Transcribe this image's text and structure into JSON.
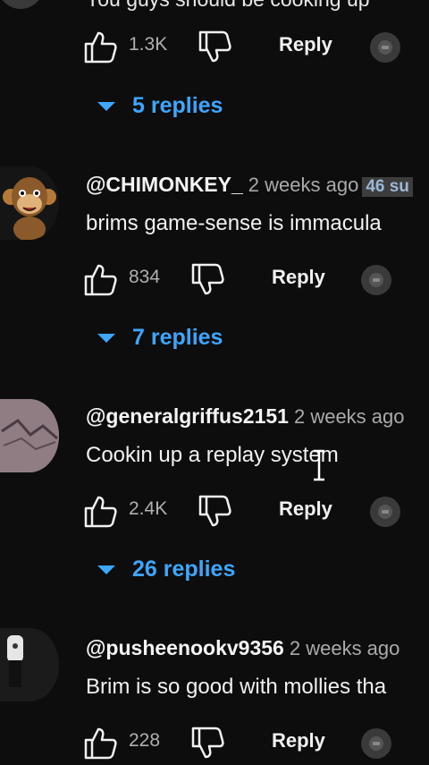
{
  "top_comment": {
    "text": "You guys should be cooking up",
    "likes": "1.3K",
    "reply_label": "Reply",
    "replies_label": "5 replies"
  },
  "comments": [
    {
      "handle": "@CHIMONKEY_",
      "time": "2 weeks ago",
      "badge": "46 su",
      "text": "brims game-sense is immacula",
      "likes": "834",
      "reply_label": "Reply",
      "replies_label": "7 replies"
    },
    {
      "handle": "@generalgriffus2151",
      "time": "2 weeks ago",
      "text": "Cookin up a replay system",
      "likes": "2.4K",
      "reply_label": "Reply",
      "replies_label": "26 replies"
    },
    {
      "handle": "@pusheenookv9356",
      "time": "2 weeks ago",
      "text": "Brim is so good with mollies tha",
      "likes": "228",
      "reply_label": "Reply"
    }
  ],
  "colors": {
    "background": "#0d0d0d",
    "accent_link": "#3ea6ff",
    "muted_text": "#aaaaaa"
  },
  "icons": [
    "thumbs-up-icon",
    "thumbs-down-icon",
    "creator-avatar-icon",
    "caret-down-icon",
    "text-cursor-icon"
  ]
}
